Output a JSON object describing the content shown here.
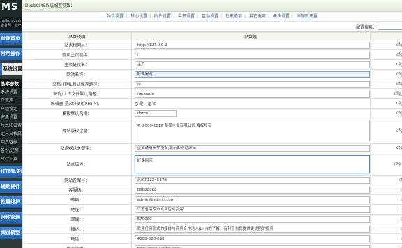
{
  "sidebar": {
    "logo": "MS",
    "user_line1": "hello, admin",
    "user_line2": "台首页 | 退出",
    "buttons_top": [
      "管理首页",
      "常用操作"
    ],
    "selected": "系统设置",
    "sub_head": "基本参数",
    "sub_items": [
      "系统设置",
      "户管理",
      "户组设定",
      "安全设置",
      "片水印设置",
      "定义文档属性",
      "用户数据",
      "备份/还原",
      "令行工具"
    ],
    "buttons_bottom": [
      "HTML更新",
      "辅助插件",
      "批量维护",
      "附件管理",
      "频道模型"
    ]
  },
  "topbar": {
    "title": "DedeCMS系统配置参数："
  },
  "tabs": [
    "站点设置",
    "核心设置",
    "附件设置",
    "会员设置",
    "互动设置",
    "性能选项",
    "其它选项",
    "模块设置",
    "添加新变量"
  ],
  "search": {
    "label": "配置搜索："
  },
  "table": {
    "headers": [
      "参数说明",
      "参数值",
      ""
    ],
    "rows": [
      {
        "label": "站点根网址：",
        "type": "input",
        "value": "http://127.0.0.1",
        "var": "cfg"
      },
      {
        "label": "网页主页链接：",
        "type": "input",
        "value": "/",
        "var": "cfg"
      },
      {
        "label": "主页链接名：",
        "type": "input",
        "value": "主页",
        "var": "cfg"
      },
      {
        "label": "网站名称：",
        "type": "input-blue",
        "value": "好课网网",
        "var": "cfg"
      },
      {
        "label": "文档HTML默认保存路径：",
        "type": "input",
        "value": "/a",
        "var": "cfg"
      },
      {
        "label": "图片/上传文件默认路径：",
        "type": "input",
        "value": "/uploads",
        "var": "cfg_"
      },
      {
        "label": "编辑器(是/否)使用XHTML：",
        "type": "radio",
        "options": [
          "是",
          "否"
        ],
        "selected": 1,
        "var": "cfg"
      },
      {
        "label": "模板默认风格：",
        "type": "input-mid",
        "value": "demo",
        "var": "cfg"
      },
      {
        "label": "网站版权信息：",
        "type": "textarea",
        "value": "© 2009-2016 某某企业有限公司 版权所有",
        "var": "cfg"
      },
      {
        "label": "站点默认关键字：",
        "type": "input",
        "value": "企业通用织梦模板,演示即网站源码",
        "var": "cfg"
      },
      {
        "label": "站点描述：",
        "type": "textarea-sel",
        "value": "好课网网",
        "var": "cfg_"
      },
      {
        "label": "网站备案号：",
        "type": "input",
        "value": "苏ICP12345678",
        "var": "cf"
      },
      {
        "label": "客服热：",
        "type": "input",
        "value": "88888888",
        "var": "c"
      },
      {
        "label": "邮箱：",
        "type": "input",
        "value": "admin@admin.com",
        "var": "c"
      },
      {
        "label": "地址：",
        "type": "input",
        "value": "江苏省南京市玄武区玄武湖",
        "var": "c"
      },
      {
        "label": "邮编：",
        "type": "input",
        "value": "570000",
        "var": "c"
      },
      {
        "label": "描述：",
        "type": "input",
        "value": "欢迎任何形式的媒体与商务合作洽入(br /)的了解，有利于为您提供更优质的服务",
        "var": "c"
      },
      {
        "label": "电话：",
        "type": "input",
        "value": "4008-888-888",
        "var": "c"
      },
      {
        "label": "新浪微博：",
        "type": "input",
        "value": "http://www.weibo.com/",
        "var": "c"
      }
    ]
  }
}
